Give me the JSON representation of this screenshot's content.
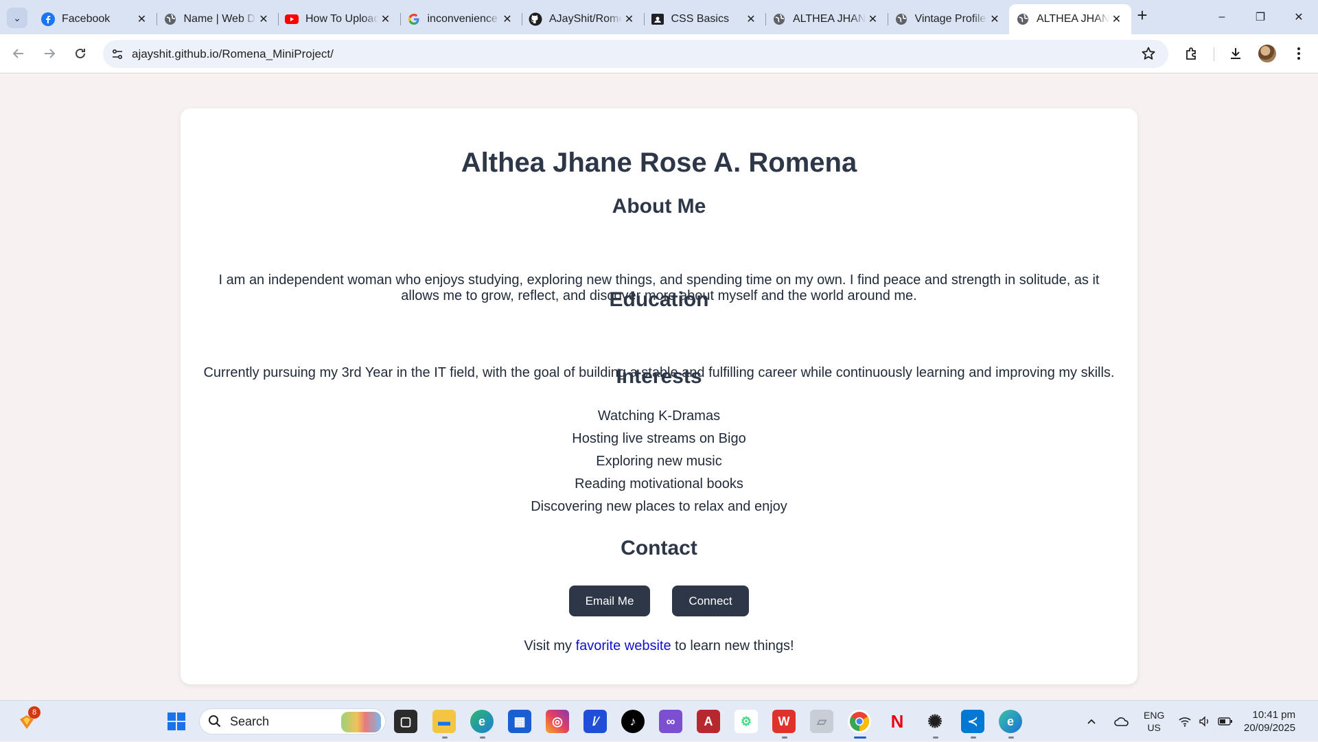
{
  "browser": {
    "tabs": [
      {
        "title": "Facebook",
        "icon": "facebook-icon",
        "active": false
      },
      {
        "title": "Name | Web Developer",
        "icon": "globe-icon",
        "active": false
      },
      {
        "title": "How To Upload",
        "icon": "youtube-icon",
        "active": false
      },
      {
        "title": "inconvenience",
        "icon": "google-icon",
        "active": false
      },
      {
        "title": "AJayShit/Romena",
        "icon": "github-icon",
        "active": false
      },
      {
        "title": "CSS Basics",
        "icon": "classroom-icon",
        "active": false
      },
      {
        "title": "ALTHEA JHANE",
        "icon": "globe-icon",
        "active": false
      },
      {
        "title": "Vintage Profile",
        "icon": "globe-icon",
        "active": false
      },
      {
        "title": "ALTHEA JHANE",
        "icon": "globe-icon",
        "active": true
      }
    ],
    "url": "ajayshit.github.io/Romena_MiniProject/",
    "new_tab_symbol": "+",
    "window_controls": [
      "–",
      "❐",
      "✕"
    ]
  },
  "page": {
    "name": "Althea Jhane Rose A. Romena",
    "about": {
      "heading": "About Me",
      "text": "I am an independent woman who enjoys studying, exploring new things, and spending time on my own. I find peace and strength in solitude, as it allows me to grow, reflect, and discover more about myself and the world around me."
    },
    "education": {
      "heading": "Education",
      "text": "Currently pursuing my 3rd Year in the IT field, with the goal of building a stable and fulfilling career while continuously learning and improving my skills."
    },
    "interests": {
      "heading": "Interests",
      "items": [
        "Watching K-Dramas",
        "Hosting live streams on Bigo",
        "Exploring new music",
        "Reading motivational books",
        "Discovering new places to relax and enjoy"
      ]
    },
    "contact": {
      "heading": "Contact",
      "email_label": "Email Me",
      "connect_label": "Connect",
      "visit_prefix": "Visit my ",
      "visit_link": "favorite website",
      "visit_suffix": " to learn new things!"
    }
  },
  "taskbar": {
    "search_placeholder": "Search",
    "notification_count": "8",
    "lang_top": "ENG",
    "lang_bottom": "US",
    "time": "10:41 pm",
    "date": "20/09/2025",
    "apps": [
      "windows-start-icon",
      "task-view-icon",
      "file-explorer-icon",
      "edge-icon",
      "microsoft-store-icon",
      "instagram-icon",
      "azure-icon",
      "tiktok-icon",
      "visual-studio-icon",
      "access-icon",
      "android-studio-icon",
      "wps-icon",
      "paper-icon",
      "chrome-icon",
      "netflix-icon",
      "chatgpt-icon",
      "vscode-icon",
      "edge-canary-icon"
    ]
  },
  "colors": {
    "accent_dark": "#2d3748",
    "link": "#1010cc",
    "page_bg": "#f7f2f1",
    "tabstrip_bg": "#dae3f3"
  }
}
